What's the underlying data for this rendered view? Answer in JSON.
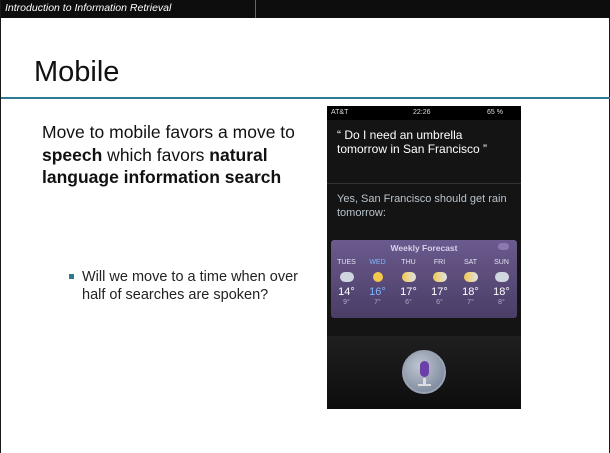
{
  "header": {
    "title": "Introduction to Information Retrieval"
  },
  "slide": {
    "title": "Mobile",
    "body": {
      "part1": "Move to mobile favors a move to ",
      "bold1": "speech",
      "part2": " which favors ",
      "bold2": "natural language information search"
    },
    "bullet": "Will we move to a time when over half of searches are spoken?"
  },
  "phone": {
    "carrier": "AT&T",
    "time": "22:26",
    "battery": "65 %",
    "question": "“ Do I need an umbrella tomorrow in San Francisco ”",
    "answer": "Yes, San Francisco should get rain tomorrow:",
    "forecast": {
      "title": "Weekly Forecast",
      "days": [
        {
          "name": "TUES",
          "high": "14°",
          "low": "9°",
          "icon": "rain-icon"
        },
        {
          "name": "WED",
          "high": "16°",
          "low": "7°",
          "icon": "sunny-icon"
        },
        {
          "name": "THU",
          "high": "17°",
          "low": "6°",
          "icon": "partly-cloudy-icon"
        },
        {
          "name": "FRI",
          "high": "17°",
          "low": "6°",
          "icon": "partly-cloudy-icon"
        },
        {
          "name": "SAT",
          "high": "18°",
          "low": "7°",
          "icon": "partly-cloudy-icon"
        },
        {
          "name": "SUN",
          "high": "18°",
          "low": "8°",
          "icon": "rain-icon"
        }
      ]
    }
  },
  "colors": {
    "accent": "#2e7a92",
    "forecast_bg": "#5a4a7a"
  }
}
